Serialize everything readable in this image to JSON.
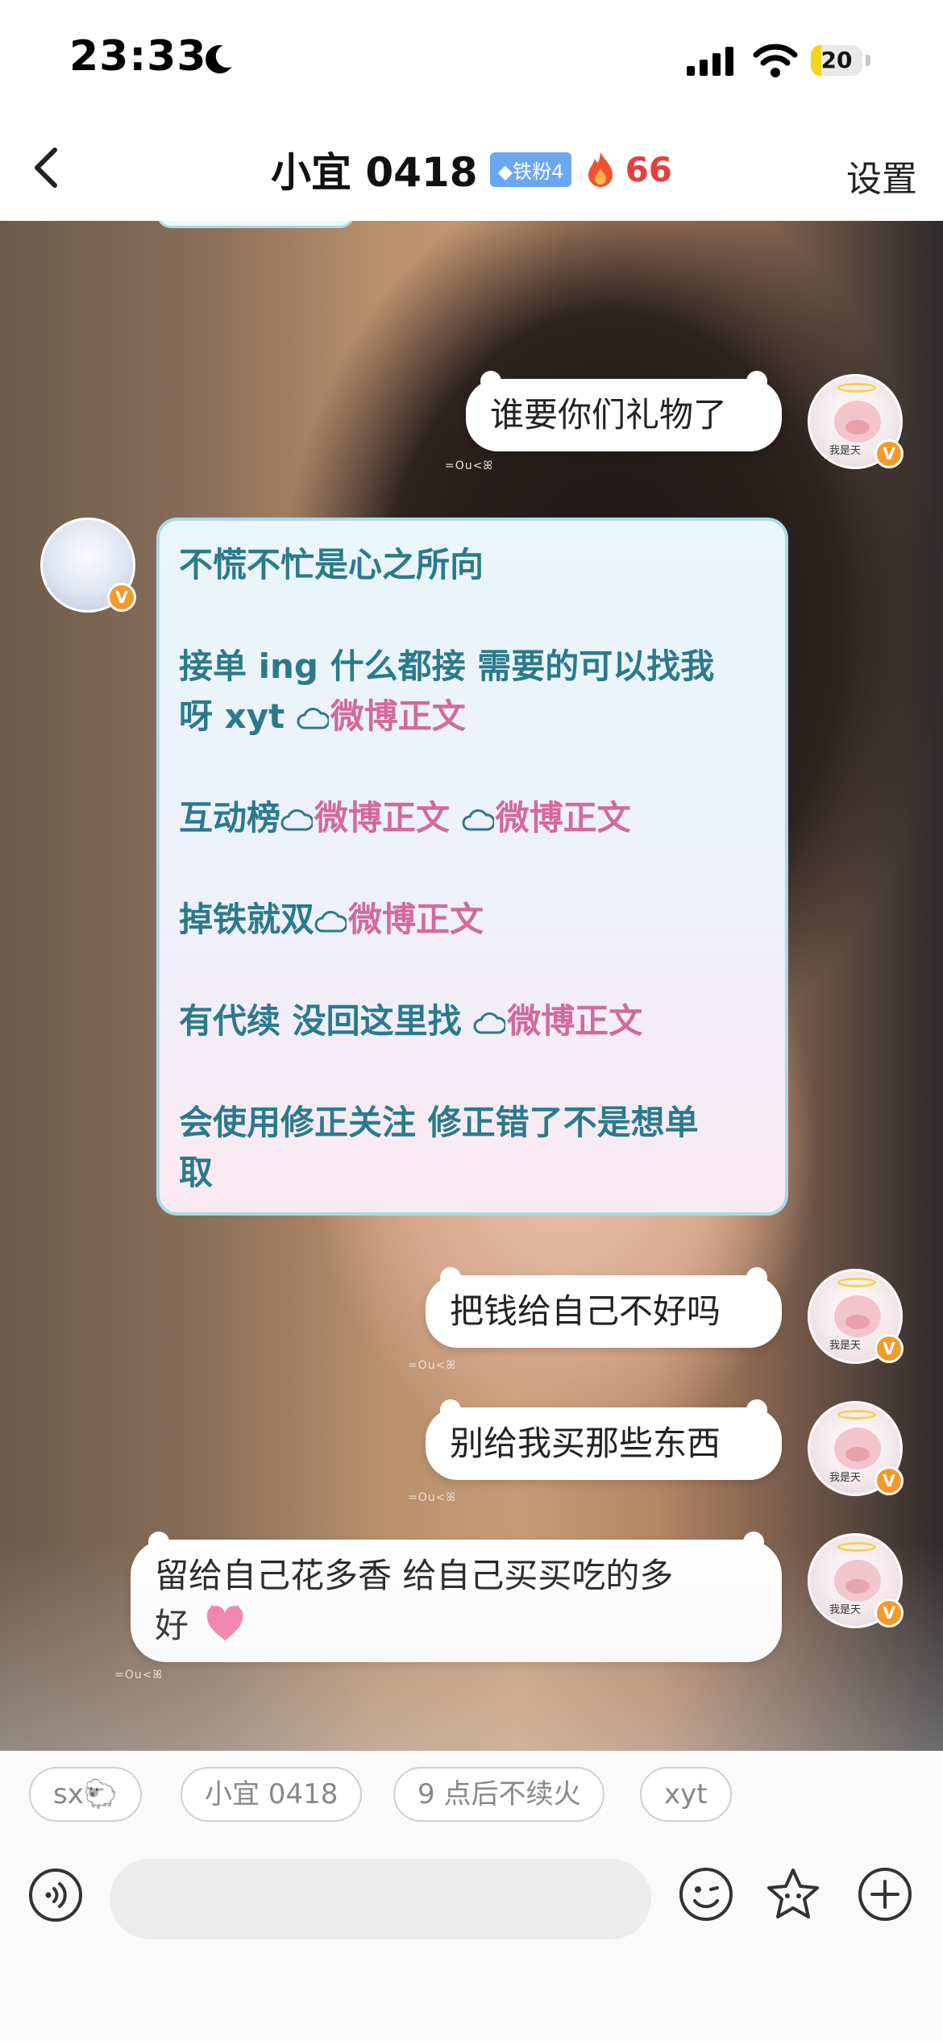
{
  "status_bar": {
    "time": "23:33",
    "battery": "20",
    "battery_level": 0.2
  },
  "header": {
    "title": "小宜 0418",
    "badge": "铁粉4",
    "streak": "66",
    "settings_label": "设置"
  },
  "messages": {
    "m1": "谁要你们礼物了",
    "note": {
      "line1": "不慌不忙是心之所向",
      "line2a": "接单 ing 什么都接 需要的可以找我",
      "line2b": "呀 xyt ",
      "link": "微博正文",
      "line3": "互动榜",
      "line4": "掉铁就双",
      "line5": "有代续 没回这里找 ",
      "line6a": "会使用修正关注 修正错了不是想单",
      "line6b": "取"
    },
    "m3": "把钱给自己不好吗",
    "m4": "别给我买那些东西",
    "m5a": "留给自己花多香 给自己买买吃的多",
    "m5b": "好"
  },
  "avatar_tag": "我是天",
  "verified_mark": "V",
  "bubble_deco": "=Ou<ꕤ",
  "quick_replies": [
    "sx🐑",
    "小宜 0418",
    "9 点后不续火",
    "xyt"
  ],
  "colors": {
    "accent_fire": "#e53f3f",
    "note_text": "#2a7a8c",
    "link": "#d16a9e",
    "badge": "#6aa7f0"
  }
}
